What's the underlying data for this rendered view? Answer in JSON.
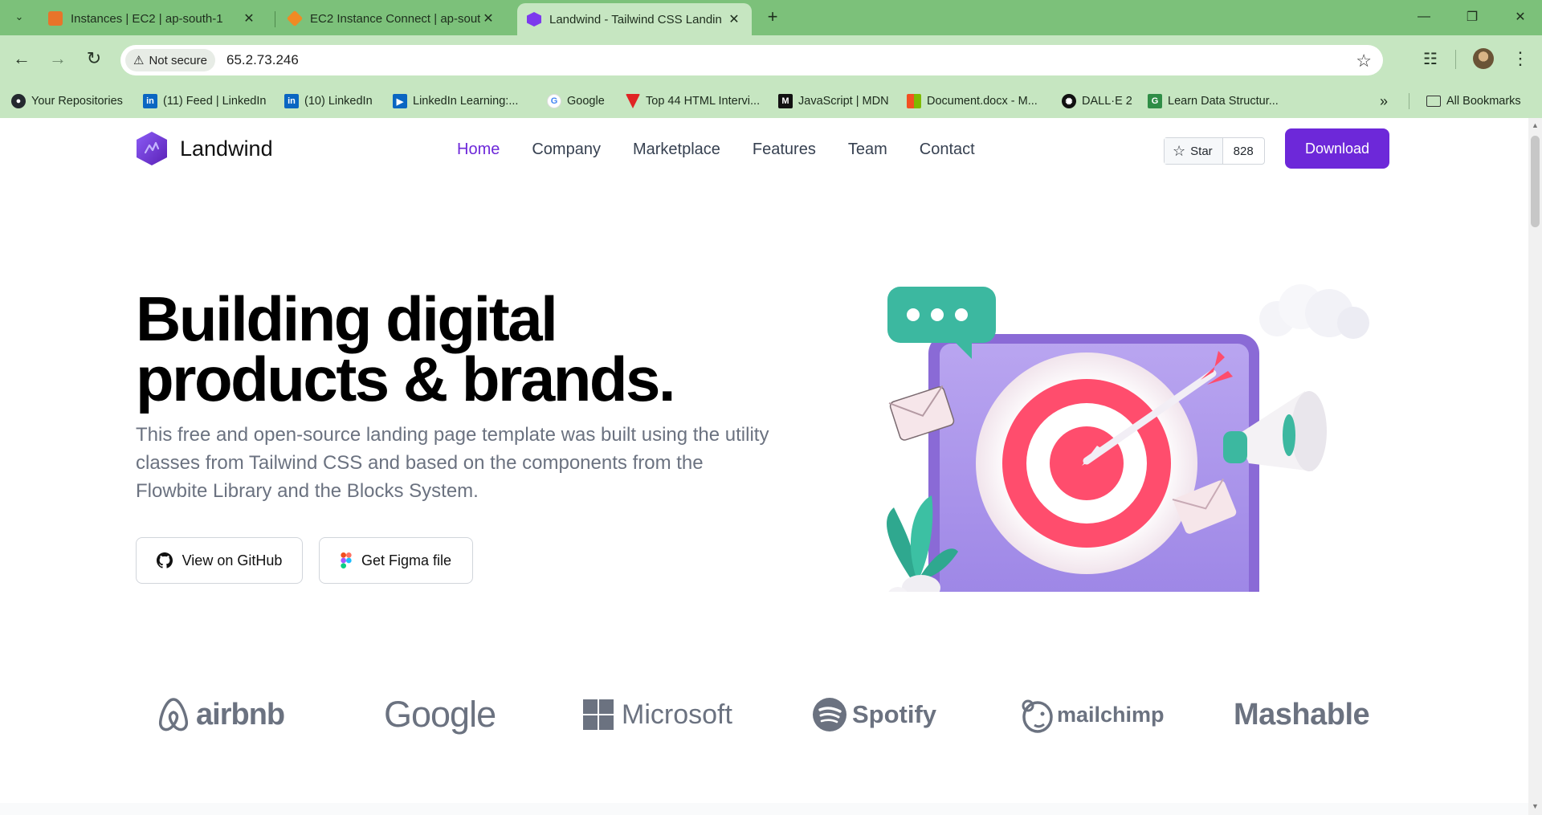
{
  "browser": {
    "tabs": [
      {
        "title": "Instances | EC2 | ap-south-1",
        "favicon_color": "#e8742a"
      },
      {
        "title": "EC2 Instance Connect | ap-south",
        "favicon_color": "#f08a24"
      },
      {
        "title": "Landwind - Tailwind CSS Landin",
        "favicon_color": "#7c3aed",
        "active": true
      }
    ],
    "address_bar": {
      "security_label": "Not secure",
      "url": "65.2.73.246"
    },
    "bookmarks": [
      {
        "label": "Your Repositories",
        "icon": "github-icon",
        "color": "#24292f"
      },
      {
        "label": "(11) Feed | LinkedIn",
        "icon": "linkedin-icon",
        "color": "#0a66c2"
      },
      {
        "label": "(10) LinkedIn",
        "icon": "linkedin-icon",
        "color": "#0a66c2"
      },
      {
        "label": "LinkedIn Learning:...",
        "icon": "linkedin-learning-icon",
        "color": "#0a66c2"
      },
      {
        "label": "Google",
        "icon": "google-icon",
        "color": "#4285f4"
      },
      {
        "label": "Top 44 HTML Intervi...",
        "icon": "tutorialspoint-icon",
        "color": "#e02424"
      },
      {
        "label": "JavaScript | MDN",
        "icon": "mdn-icon",
        "color": "#111111"
      },
      {
        "label": "Document.docx - M...",
        "icon": "microsoft-icon",
        "color": "#f25022"
      },
      {
        "label": "DALL·E 2",
        "icon": "openai-icon",
        "color": "#111111"
      },
      {
        "label": "Learn Data Structur...",
        "icon": "gfg-icon",
        "color": "#2f8d46"
      }
    ],
    "all_bookmarks_label": "All Bookmarks"
  },
  "site": {
    "brand": "Landwind",
    "brand_color": "#7c3aed",
    "nav": [
      "Home",
      "Company",
      "Marketplace",
      "Features",
      "Team",
      "Contact"
    ],
    "active_nav": "Home",
    "github_star_label": "Star",
    "github_star_count": "828",
    "download_label": "Download",
    "accent_color": "#6d28d9"
  },
  "hero": {
    "title_line1": "Building digital",
    "title_line2": "products & brands.",
    "description": "This free and open-source landing page template was built using the utility classes from Tailwind CSS and based on the components from the Flowbite Library and the Blocks System.",
    "primary_button": "View on GitHub",
    "secondary_button": "Get Figma file"
  },
  "customer_logos": [
    "airbnb",
    "Google",
    "Microsoft",
    "Spotify",
    "mailchimp",
    "Mashable"
  ]
}
